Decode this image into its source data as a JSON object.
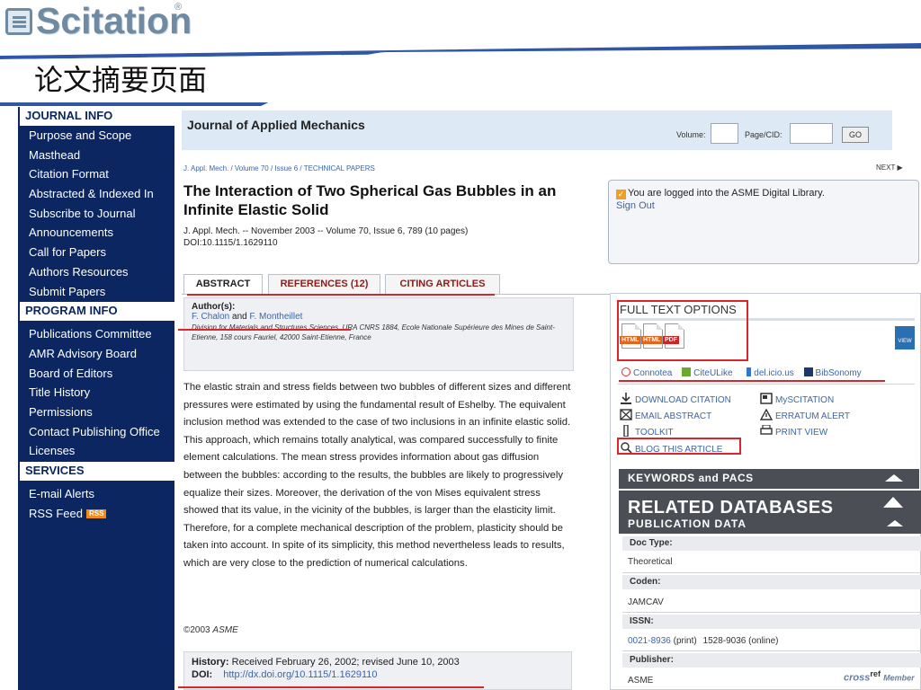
{
  "brand": {
    "logo_text": "Scitation",
    "logo_reg": "®"
  },
  "slide_title": "论文摘要页面",
  "sidebar": {
    "journal_info": {
      "heading": "JOURNAL INFO",
      "items": [
        "Purpose and Scope",
        "Masthead",
        "Citation Format",
        "Abstracted & Indexed In",
        "Subscribe to Journal",
        "Announcements",
        "Call for Papers",
        "Authors Resources",
        "Submit Papers"
      ]
    },
    "program_info": {
      "heading": "PROGRAM INFO",
      "items": [
        "Publications Committee",
        "AMR Advisory Board",
        "Board of Editors",
        "Title History",
        "Permissions",
        "Contact Publishing Office",
        "Licenses"
      ]
    },
    "services": {
      "heading": "SERVICES",
      "items": [
        "E-mail Alerts",
        "RSS Feed"
      ],
      "rss_badge": "RSS"
    }
  },
  "journal_bar": {
    "name": "Journal of Applied Mechanics",
    "volume_label": "Volume:",
    "page_label": "Page/CID:",
    "volume_value": "",
    "page_value": "",
    "go_label": "GO"
  },
  "article": {
    "breadcrumb": "J. Appl. Mech. / Volume 70 / Issue 6 / TECHNICAL PAPERS",
    "next_label": "NEXT",
    "title": "The Interaction of Two Spherical Gas Bubbles in an Infinite Elastic Solid",
    "meta_line1": "J. Appl. Mech. -- November 2003 -- Volume 70, Issue 6, 789 (10 pages)",
    "meta_line2": "DOI:10.1115/1.1629110"
  },
  "login": {
    "message": "You are logged into the ASME Digital Library.",
    "sign_out": "Sign Out"
  },
  "tabs": {
    "abstract": "ABSTRACT",
    "references": "REFERENCES (12)",
    "citing": "CITING ARTICLES"
  },
  "authors": {
    "label": "Author(s):",
    "name1": "F. Chalon",
    "joiner": "and",
    "name2": "F. Montheillet",
    "affiliation": "Division for Materials and Structures Sciences, URA CNRS 1884, Ecole Nationale Supérieure des Mines de Saint-Etienne, 158 cours Fauriel, 42000 Saint-Etienne, France"
  },
  "abstract_text": "The elastic strain and stress fields between two bubbles of different sizes and different pressures were estimated by using the fundamental result of Eshelby. The equivalent inclusion method was extended to the case of two inclusions in an infinite elastic solid. This approach, which remains totally analytical, was compared successfully to finite element calculations. The mean stress provides information about gas diffusion between the bubbles: according to the results, the bubbles are likely to progressively equalize their sizes. Moreover, the derivation of the von Mises equivalent stress showed that its value, in the vicinity of the bubbles, is larger than the elasticity limit. Therefore, for a complete mechanical description of the problem, plasticity should be taken into account. In spite of its simplicity, this method nevertheless leads to results, which are very close to the prediction of numerical calculations.",
  "copyright": {
    "prefix": "©2003 ",
    "org": "ASME"
  },
  "history": {
    "history_label": "History:",
    "history_text": "Received February 26, 2002; revised June 10, 2003",
    "doi_label": "DOI:",
    "doi_link": "http://dx.doi.org/10.1115/1.1629110"
  },
  "full_text": {
    "title": "FULL TEXT OPTIONS",
    "formats": [
      "HTML",
      "HTML",
      "PDF"
    ],
    "view_label": "VIEW",
    "social": [
      "Connotea",
      "CiteULike",
      "del.icio.us",
      "BibSonomy"
    ]
  },
  "tools": {
    "download_citation": "DOWNLOAD CITATION",
    "myscitation": "MySCITATION",
    "email_abstract": "EMAIL ABSTRACT",
    "erratum_alert": "ERRATUM ALERT",
    "toolkit": "TOOLKIT",
    "print_view": "PRINT VIEW",
    "blog": "BLOG THIS ARTICLE"
  },
  "keywords_panel": {
    "title": "KEYWORDS and PACS"
  },
  "related": {
    "title": "RELATED DATABASES",
    "subtitle": "PUBLICATION DATA",
    "doc_type_label": "Doc Type:",
    "doc_type_value": "Theoretical",
    "coden_label": "Coden:",
    "coden_value": "JAMCAV",
    "issn_label": "ISSN:",
    "issn_print": "0021-8936",
    "issn_print_suffix": "(print)",
    "issn_online": "1528-9036 (online)",
    "publisher_label": "Publisher:",
    "publisher_value": "ASME",
    "crossref_text": "cross",
    "crossref_ref": "ref",
    "crossref_member": "Member"
  },
  "colors": {
    "sidebar_bg": "#0b2660",
    "highlight_red": "#d9252b",
    "link_blue": "#3b66a8",
    "logo_gray_blue": "#6f8aa3",
    "journal_bar_bg": "#dde9f5"
  }
}
